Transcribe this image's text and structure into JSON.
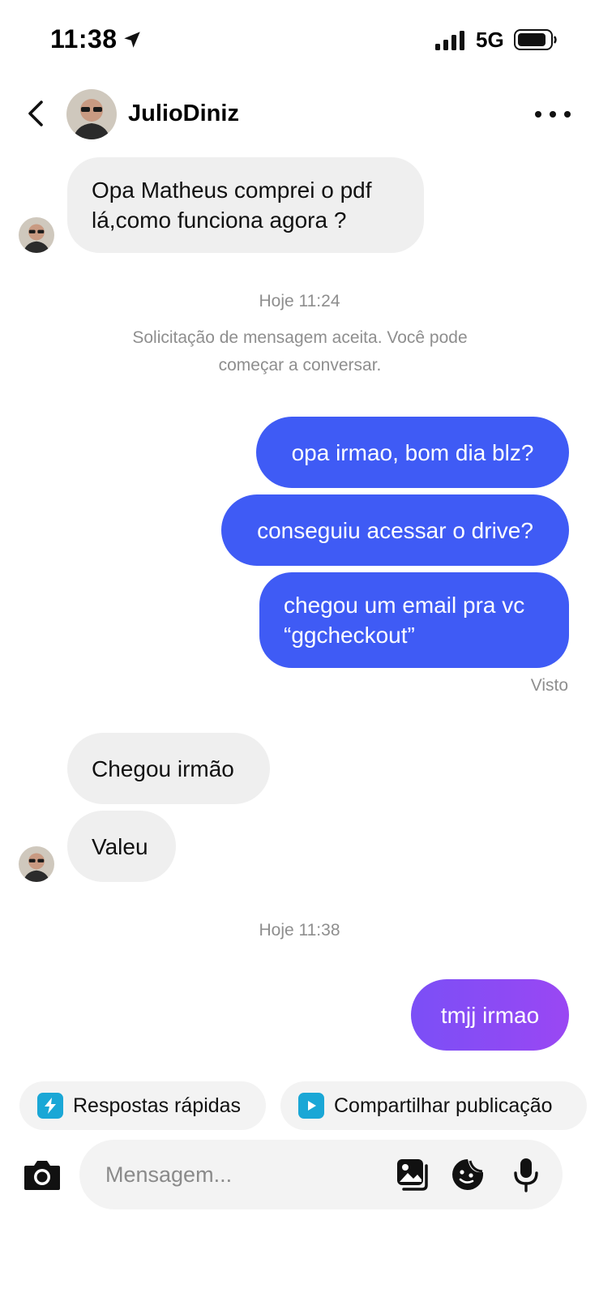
{
  "status_bar": {
    "time": "11:38",
    "network": "5G",
    "icons": [
      "location-arrow-icon",
      "cellular-signal-icon",
      "battery-icon"
    ]
  },
  "header": {
    "username": "JulioDiniz",
    "icons": [
      "back-chevron-icon",
      "more-options-icon"
    ]
  },
  "messages": [
    {
      "from": "them",
      "text_lines": [
        "Opa Matheus comprei o pdf",
        "lá,como funciona agora ?"
      ]
    },
    {
      "type": "timestamp",
      "text": "Hoje 11:24"
    },
    {
      "type": "system",
      "text_lines": [
        "Solicitação de mensagem aceita. Você pode",
        "começar a conversar."
      ]
    },
    {
      "from": "me",
      "text": "opa irmao, bom dia blz?"
    },
    {
      "from": "me",
      "text": "conseguiu acessar o drive?"
    },
    {
      "from": "me",
      "text_lines": [
        "chegou um email pra vc",
        "“ggcheckout”"
      ]
    },
    {
      "type": "seen",
      "text": "Visto"
    },
    {
      "from": "them",
      "text": "Chegou irmão"
    },
    {
      "from": "them",
      "text": "Valeu"
    },
    {
      "type": "timestamp",
      "text": "Hoje 11:38"
    },
    {
      "from": "me",
      "text": "tmjj irmao"
    }
  ],
  "quick_actions": [
    {
      "label": "Respostas rápidas",
      "icon": "lightning-icon"
    },
    {
      "label": "Compartilhar publicação",
      "icon": "play-icon"
    }
  ],
  "composer": {
    "placeholder": "Mensagem...",
    "icons": [
      "camera-icon",
      "gallery-icon",
      "sticker-icon",
      "microphone-icon"
    ]
  },
  "colors": {
    "outgoing_bubble": "#3f5bf5",
    "outgoing_gradient_start": "#7b4ff6",
    "outgoing_gradient_end": "#9a47f3",
    "incoming_bubble": "#efefef",
    "secondary_text": "#8e8e8e",
    "quick_reply_icon": "#1aa7d6"
  }
}
